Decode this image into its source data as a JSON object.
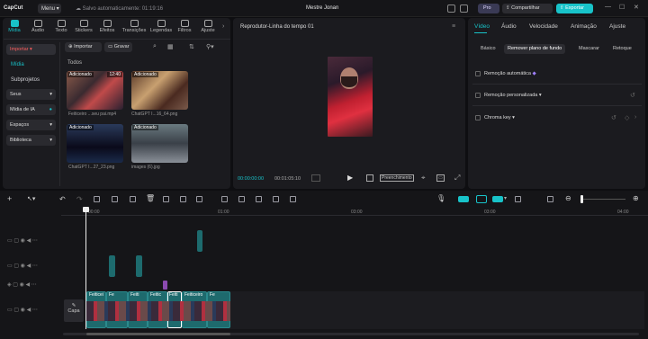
{
  "app": {
    "logo": "CapCut",
    "menu": "Menu",
    "autosave": "Salvo automaticamente: 01:19:16",
    "project_title": "Mestre Jonan",
    "pro": "Pro",
    "share": "Compartilhar",
    "export": "Exportar"
  },
  "tools": [
    {
      "label": "Mídia"
    },
    {
      "label": "Áudio"
    },
    {
      "label": "Texto"
    },
    {
      "label": "Stickers"
    },
    {
      "label": "Efeitos"
    },
    {
      "label": "Transições"
    },
    {
      "label": "Legendas"
    },
    {
      "label": "Filtros"
    },
    {
      "label": "Ajuste"
    }
  ],
  "sidebar": {
    "import_label": "Importar",
    "items": [
      "Mídia",
      "Subprojetos",
      "Seus",
      "Mídia de IA",
      "Espaços",
      "Biblioteca"
    ]
  },
  "media": {
    "import_btn": "Importar",
    "record_btn": "Gravar",
    "filter_all": "Todos",
    "items": [
      {
        "name": "Feiticeiro ...seu pai.mp4",
        "badge": "Adicionado",
        "duration": "12:40"
      },
      {
        "name": "ChatGPT I...16_64.png",
        "badge": "Adicionado"
      },
      {
        "name": "ChatGPT I...27_23.png",
        "badge": "Adicionado"
      },
      {
        "name": "images (6).jpg",
        "badge": "Adicionado"
      }
    ]
  },
  "player": {
    "title": "Reprodutor-Linha do tempo 01",
    "time_current": "00:00:00:00",
    "time_total": "00:01:05:10",
    "fill_label": "Preenchimento"
  },
  "props": {
    "tabs": [
      "Vídeo",
      "Áudio",
      "Velocidade",
      "Animação",
      "Ajuste"
    ],
    "subtabs": [
      "Básico",
      "Remover plano de fundo",
      "Mascarar",
      "Retoque"
    ],
    "options": [
      "Remoção automática",
      "Remoção personalizada",
      "Chroma key"
    ]
  },
  "timeline": {
    "ruler": [
      "00:00",
      "01:00",
      "03:00",
      "03:00",
      "04:00"
    ],
    "cover": "Capa",
    "clips": [
      "Feiticei",
      "Fe",
      "Feiti",
      "Feitic",
      "Feiti",
      "Feiticeiro",
      "Fe"
    ]
  }
}
